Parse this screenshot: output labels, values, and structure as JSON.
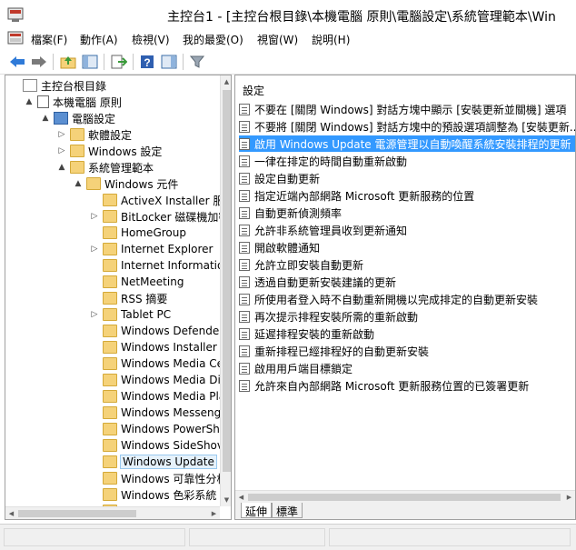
{
  "window": {
    "title": "主控台1 - [主控台根目錄\\本機電腦 原則\\電腦設定\\系統管理範本\\Win",
    "icon": "mmc-console-icon"
  },
  "menu": {
    "items": [
      "檔案(F)",
      "動作(A)",
      "檢視(V)",
      "我的最愛(O)",
      "視窗(W)",
      "說明(H)"
    ]
  },
  "toolbar": {
    "buttons": [
      "back-arrow-icon",
      "forward-arrow-icon",
      "up-folder-icon",
      "show-hide-tree-icon",
      "export-list-icon",
      "help-icon",
      "show-hide-action-pane-icon",
      "filter-icon"
    ]
  },
  "tree": {
    "rows": [
      {
        "label": "主控台根目錄",
        "icon": "console-root-icon",
        "expander": ""
      },
      {
        "label": "本機電腦 原則",
        "icon": "policy-icon",
        "expander": "▲"
      },
      {
        "label": "電腦設定",
        "icon": "computer-icon",
        "expander": "▲"
      },
      {
        "label": "軟體設定",
        "icon": "folder-icon",
        "expander": "▷"
      },
      {
        "label": "Windows 設定",
        "icon": "folder-icon",
        "expander": "▷"
      },
      {
        "label": "系統管理範本",
        "icon": "folder-icon",
        "expander": "▲"
      },
      {
        "label": "Windows 元件",
        "icon": "folder-icon",
        "expander": "▲"
      },
      {
        "label": "ActiveX Installer 服務",
        "icon": "folder-icon",
        "expander": ""
      },
      {
        "label": "BitLocker 磁碟機加密",
        "icon": "folder-icon",
        "expander": "▷"
      },
      {
        "label": "HomeGroup",
        "icon": "folder-icon",
        "expander": ""
      },
      {
        "label": "Internet Explorer",
        "icon": "folder-icon",
        "expander": "▷"
      },
      {
        "label": "Internet Information",
        "icon": "folder-icon",
        "expander": ""
      },
      {
        "label": "NetMeeting",
        "icon": "folder-icon",
        "expander": ""
      },
      {
        "label": "RSS 摘要",
        "icon": "folder-icon",
        "expander": ""
      },
      {
        "label": "Tablet PC",
        "icon": "folder-icon",
        "expander": "▷"
      },
      {
        "label": "Windows Defender",
        "icon": "folder-icon",
        "expander": ""
      },
      {
        "label": "Windows Installer",
        "icon": "folder-icon",
        "expander": ""
      },
      {
        "label": "Windows Media Ce",
        "icon": "folder-icon",
        "expander": ""
      },
      {
        "label": "Windows Media Di",
        "icon": "folder-icon",
        "expander": ""
      },
      {
        "label": "Windows Media Pla",
        "icon": "folder-icon",
        "expander": ""
      },
      {
        "label": "Windows Messeng",
        "icon": "folder-icon",
        "expander": ""
      },
      {
        "label": "Windows PowerShe",
        "icon": "folder-icon",
        "expander": ""
      },
      {
        "label": "Windows SideShov",
        "icon": "folder-icon",
        "expander": ""
      },
      {
        "label": "Windows Update",
        "icon": "folder-icon",
        "expander": "",
        "selected": true
      },
      {
        "label": "Windows 可靠性分析",
        "icon": "folder-icon",
        "expander": ""
      },
      {
        "label": "Windows 色彩系統",
        "icon": "folder-icon",
        "expander": ""
      },
      {
        "label": "",
        "icon": "folder-icon",
        "expander": ""
      }
    ]
  },
  "list": {
    "header": "設定",
    "items": [
      "不要在 [關閉 Windows] 對話方塊中顯示 [安裝更新並關機] 選項",
      "不要將 [關閉 Windows] 對話方塊中的預設選項調整為 [安裝更新...",
      "啟用 Windows Update 電源管理以自動喚醒系統安裝排程的更新",
      "一律在排定的時間自動重新啟動",
      "設定自動更新",
      "指定近端內部網路 Microsoft 更新服務的位置",
      "自動更新偵測頻率",
      "允許非系統管理員收到更新通知",
      "開啟軟體通知",
      "允許立即安裝自動更新",
      "透過自動更新安裝建議的更新",
      "所使用者登入時不自動重新開機以完成排定的自動更新安裝",
      "再次提示排程安裝所需的重新啟動",
      "延遲排程安裝的重新啟動",
      "重新排程已經排程好的自動更新安裝",
      "啟用用戶端目標鎖定",
      "允許來自內部網路 Microsoft 更新服務位置的已簽署更新"
    ],
    "selected_index": 2
  },
  "tabs": [
    "延伸",
    "標準"
  ],
  "colors": {
    "selection": "#3399ff",
    "folder": "#f5d279"
  }
}
